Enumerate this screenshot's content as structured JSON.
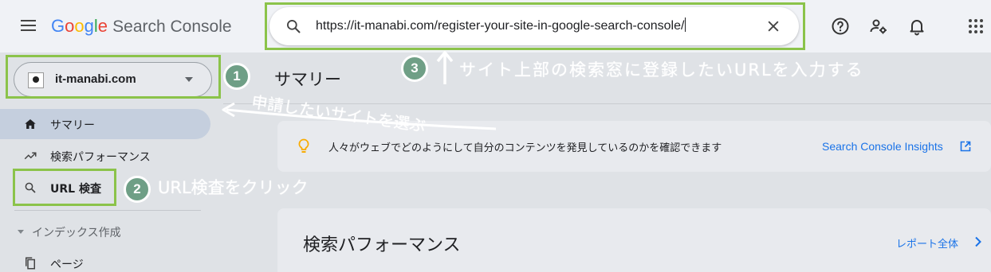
{
  "header": {
    "logo_google": [
      "G",
      "o",
      "o",
      "g",
      "l",
      "e"
    ],
    "logo_product": "Search Console",
    "search_value": "https://it-manabi.com/register-your-site-in-google-search-console/"
  },
  "icons": {
    "menu": "hamburger-icon",
    "search": "search-icon",
    "clear": "close-icon",
    "help": "help-icon",
    "settings": "person-settings-icon",
    "notifications": "bell-icon",
    "apps": "apps-grid-icon"
  },
  "sidebar": {
    "property": "it-manabi.com",
    "items": [
      {
        "label": "サマリー",
        "icon": "home-icon",
        "active": true
      },
      {
        "label": "検索パフォーマンス",
        "icon": "trending-icon",
        "active": false
      },
      {
        "label": "URL 検査",
        "icon": "search-icon",
        "active": false
      }
    ],
    "section": "インデックス作成",
    "section_items": [
      {
        "label": "ページ",
        "icon": "pages-icon"
      }
    ]
  },
  "main": {
    "title": "サマリー",
    "insight_text": "人々がウェブでどのようにして自分のコンテンツを発見しているのかを確認できます",
    "insight_link": "Search Console Insights",
    "perf_title": "検索パフォーマンス",
    "perf_link": "レポート全体"
  },
  "annotations": {
    "step1_number": "1",
    "step1_text": "申請したいサイトを選ぶ",
    "step2_number": "2",
    "step2_text": "URL検査をクリック",
    "step3_number": "3",
    "step3_text": "サイト上部の検索窓に登録したいURLを入力する"
  },
  "colors": {
    "highlight": "#8bc34a",
    "annotation_circle": "#6f9f86",
    "link": "#1a73e8",
    "active_nav": "#c5cfde"
  }
}
